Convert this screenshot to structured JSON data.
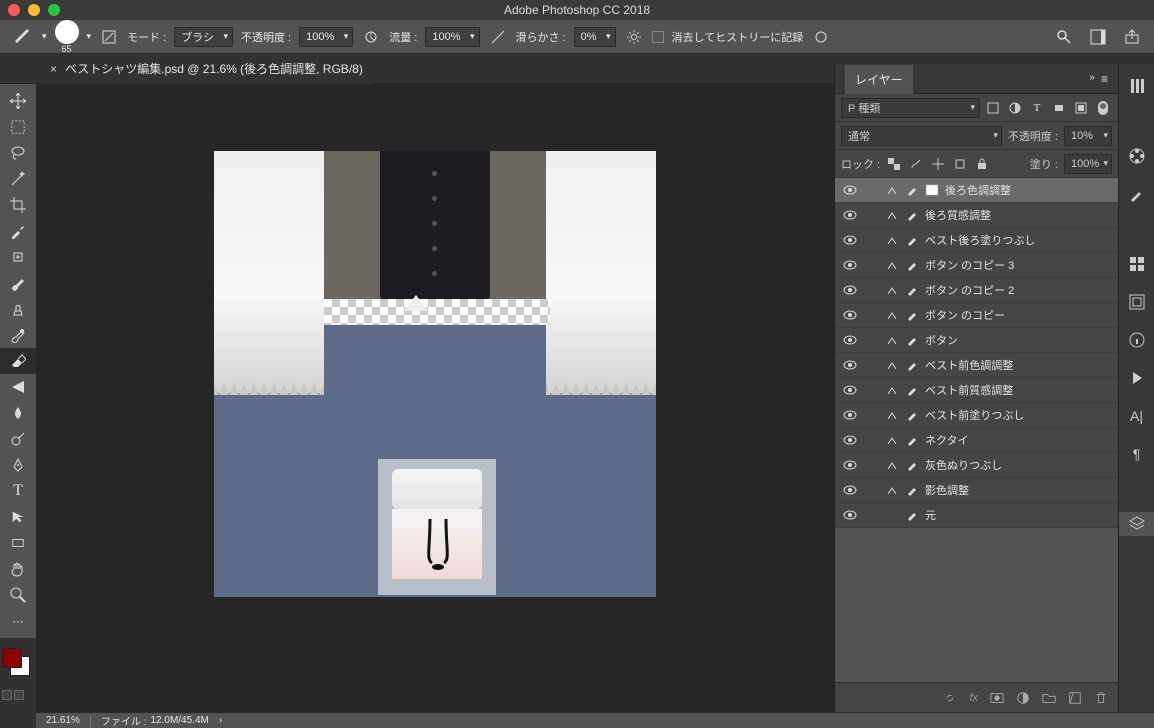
{
  "app": {
    "title": "Adobe Photoshop CC 2018"
  },
  "document": {
    "tab_label": "ベストシャツ編集.psd @ 21.6% (後ろ色調調整, RGB/8)"
  },
  "optionsbar": {
    "brush_size": "65",
    "mode_label": "モード :",
    "mode_value": "ブラシ",
    "opacity_label": "不透明度 :",
    "opacity_value": "100%",
    "flow_label": "流量 :",
    "flow_value": "100%",
    "smoothing_label": "滑らかさ :",
    "smoothing_value": "0%",
    "history_label": "消去してヒストリーに記録"
  },
  "layers_panel": {
    "title": "レイヤー",
    "filter_placeholder": "P 種類",
    "blend_mode": "通常",
    "opacity_label": "不透明度 :",
    "opacity_value": "10%",
    "lock_label": "ロック :",
    "fill_label": "塗り :",
    "fill_value": "100%",
    "layers": [
      {
        "name": "後ろ色調調整",
        "selected": true,
        "hasMask": true
      },
      {
        "name": "後ろ質感調整",
        "hasMask": true
      },
      {
        "name": "ベスト後ろ塗りつぶし",
        "hasMask": true
      },
      {
        "name": "ボタン のコピー 3",
        "hasMask": true
      },
      {
        "name": "ボタン のコピー 2",
        "hasMask": true
      },
      {
        "name": "ボタン のコピー",
        "hasMask": true
      },
      {
        "name": "ボタン",
        "hasMask": true
      },
      {
        "name": "ベスト前色調調整",
        "hasMask": true
      },
      {
        "name": "ベスト前質感調整",
        "hasMask": true
      },
      {
        "name": "ベスト前塗りつぶし",
        "hasMask": true
      },
      {
        "name": "ネクタイ",
        "hasMask": true
      },
      {
        "name": "灰色ぬりつぶし",
        "hasMask": true
      },
      {
        "name": "影色調整",
        "hasMask": true
      },
      {
        "name": "元",
        "hasMask": false
      }
    ]
  },
  "statusbar": {
    "zoom": "21.61%",
    "file_label": "ファイル :",
    "file_info": "12.0M/45.4M"
  }
}
